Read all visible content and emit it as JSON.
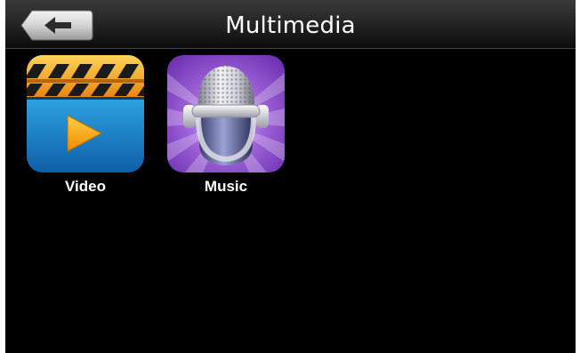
{
  "header": {
    "title": "Multimedia",
    "back_icon": "left-arrow-icon"
  },
  "apps": [
    {
      "label": "Video",
      "icon": "clapperboard-play-icon",
      "colors": {
        "stripe": "#f7a21b",
        "screen": "#1f8fd6",
        "play": "#f9a51a"
      }
    },
    {
      "label": "Music",
      "icon": "microphone-icon",
      "colors": {
        "background": "#8a49c6",
        "grille": "#c8c8d0"
      }
    }
  ]
}
